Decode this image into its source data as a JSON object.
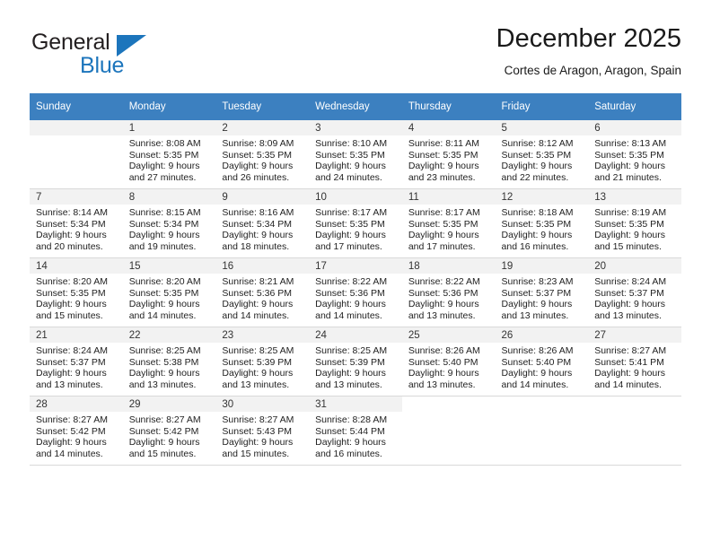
{
  "brand": {
    "name_top": "General",
    "name_bottom": "Blue",
    "triangle_color": "#1c75bc"
  },
  "header": {
    "title": "December 2025",
    "subtitle": "Cortes de Aragon, Aragon, Spain"
  },
  "weekday_headers": [
    "Sunday",
    "Monday",
    "Tuesday",
    "Wednesday",
    "Thursday",
    "Friday",
    "Saturday"
  ],
  "colors": {
    "header_row_bg": "#3c80c0",
    "header_row_text": "#ffffff",
    "daynum_bg": "#f2f2f2",
    "cell_border": "#d9d9d9",
    "text": "#222222"
  },
  "weeks": [
    [
      {
        "day": "",
        "sunrise": "",
        "sunset": "",
        "daylight_line1": "",
        "daylight_line2": ""
      },
      {
        "day": "1",
        "sunrise": "Sunrise: 8:08 AM",
        "sunset": "Sunset: 5:35 PM",
        "daylight_line1": "Daylight: 9 hours",
        "daylight_line2": "and 27 minutes."
      },
      {
        "day": "2",
        "sunrise": "Sunrise: 8:09 AM",
        "sunset": "Sunset: 5:35 PM",
        "daylight_line1": "Daylight: 9 hours",
        "daylight_line2": "and 26 minutes."
      },
      {
        "day": "3",
        "sunrise": "Sunrise: 8:10 AM",
        "sunset": "Sunset: 5:35 PM",
        "daylight_line1": "Daylight: 9 hours",
        "daylight_line2": "and 24 minutes."
      },
      {
        "day": "4",
        "sunrise": "Sunrise: 8:11 AM",
        "sunset": "Sunset: 5:35 PM",
        "daylight_line1": "Daylight: 9 hours",
        "daylight_line2": "and 23 minutes."
      },
      {
        "day": "5",
        "sunrise": "Sunrise: 8:12 AM",
        "sunset": "Sunset: 5:35 PM",
        "daylight_line1": "Daylight: 9 hours",
        "daylight_line2": "and 22 minutes."
      },
      {
        "day": "6",
        "sunrise": "Sunrise: 8:13 AM",
        "sunset": "Sunset: 5:35 PM",
        "daylight_line1": "Daylight: 9 hours",
        "daylight_line2": "and 21 minutes."
      }
    ],
    [
      {
        "day": "7",
        "sunrise": "Sunrise: 8:14 AM",
        "sunset": "Sunset: 5:34 PM",
        "daylight_line1": "Daylight: 9 hours",
        "daylight_line2": "and 20 minutes."
      },
      {
        "day": "8",
        "sunrise": "Sunrise: 8:15 AM",
        "sunset": "Sunset: 5:34 PM",
        "daylight_line1": "Daylight: 9 hours",
        "daylight_line2": "and 19 minutes."
      },
      {
        "day": "9",
        "sunrise": "Sunrise: 8:16 AM",
        "sunset": "Sunset: 5:34 PM",
        "daylight_line1": "Daylight: 9 hours",
        "daylight_line2": "and 18 minutes."
      },
      {
        "day": "10",
        "sunrise": "Sunrise: 8:17 AM",
        "sunset": "Sunset: 5:35 PM",
        "daylight_line1": "Daylight: 9 hours",
        "daylight_line2": "and 17 minutes."
      },
      {
        "day": "11",
        "sunrise": "Sunrise: 8:17 AM",
        "sunset": "Sunset: 5:35 PM",
        "daylight_line1": "Daylight: 9 hours",
        "daylight_line2": "and 17 minutes."
      },
      {
        "day": "12",
        "sunrise": "Sunrise: 8:18 AM",
        "sunset": "Sunset: 5:35 PM",
        "daylight_line1": "Daylight: 9 hours",
        "daylight_line2": "and 16 minutes."
      },
      {
        "day": "13",
        "sunrise": "Sunrise: 8:19 AM",
        "sunset": "Sunset: 5:35 PM",
        "daylight_line1": "Daylight: 9 hours",
        "daylight_line2": "and 15 minutes."
      }
    ],
    [
      {
        "day": "14",
        "sunrise": "Sunrise: 8:20 AM",
        "sunset": "Sunset: 5:35 PM",
        "daylight_line1": "Daylight: 9 hours",
        "daylight_line2": "and 15 minutes."
      },
      {
        "day": "15",
        "sunrise": "Sunrise: 8:20 AM",
        "sunset": "Sunset: 5:35 PM",
        "daylight_line1": "Daylight: 9 hours",
        "daylight_line2": "and 14 minutes."
      },
      {
        "day": "16",
        "sunrise": "Sunrise: 8:21 AM",
        "sunset": "Sunset: 5:36 PM",
        "daylight_line1": "Daylight: 9 hours",
        "daylight_line2": "and 14 minutes."
      },
      {
        "day": "17",
        "sunrise": "Sunrise: 8:22 AM",
        "sunset": "Sunset: 5:36 PM",
        "daylight_line1": "Daylight: 9 hours",
        "daylight_line2": "and 14 minutes."
      },
      {
        "day": "18",
        "sunrise": "Sunrise: 8:22 AM",
        "sunset": "Sunset: 5:36 PM",
        "daylight_line1": "Daylight: 9 hours",
        "daylight_line2": "and 13 minutes."
      },
      {
        "day": "19",
        "sunrise": "Sunrise: 8:23 AM",
        "sunset": "Sunset: 5:37 PM",
        "daylight_line1": "Daylight: 9 hours",
        "daylight_line2": "and 13 minutes."
      },
      {
        "day": "20",
        "sunrise": "Sunrise: 8:24 AM",
        "sunset": "Sunset: 5:37 PM",
        "daylight_line1": "Daylight: 9 hours",
        "daylight_line2": "and 13 minutes."
      }
    ],
    [
      {
        "day": "21",
        "sunrise": "Sunrise: 8:24 AM",
        "sunset": "Sunset: 5:37 PM",
        "daylight_line1": "Daylight: 9 hours",
        "daylight_line2": "and 13 minutes."
      },
      {
        "day": "22",
        "sunrise": "Sunrise: 8:25 AM",
        "sunset": "Sunset: 5:38 PM",
        "daylight_line1": "Daylight: 9 hours",
        "daylight_line2": "and 13 minutes."
      },
      {
        "day": "23",
        "sunrise": "Sunrise: 8:25 AM",
        "sunset": "Sunset: 5:39 PM",
        "daylight_line1": "Daylight: 9 hours",
        "daylight_line2": "and 13 minutes."
      },
      {
        "day": "24",
        "sunrise": "Sunrise: 8:25 AM",
        "sunset": "Sunset: 5:39 PM",
        "daylight_line1": "Daylight: 9 hours",
        "daylight_line2": "and 13 minutes."
      },
      {
        "day": "25",
        "sunrise": "Sunrise: 8:26 AM",
        "sunset": "Sunset: 5:40 PM",
        "daylight_line1": "Daylight: 9 hours",
        "daylight_line2": "and 13 minutes."
      },
      {
        "day": "26",
        "sunrise": "Sunrise: 8:26 AM",
        "sunset": "Sunset: 5:40 PM",
        "daylight_line1": "Daylight: 9 hours",
        "daylight_line2": "and 14 minutes."
      },
      {
        "day": "27",
        "sunrise": "Sunrise: 8:27 AM",
        "sunset": "Sunset: 5:41 PM",
        "daylight_line1": "Daylight: 9 hours",
        "daylight_line2": "and 14 minutes."
      }
    ],
    [
      {
        "day": "28",
        "sunrise": "Sunrise: 8:27 AM",
        "sunset": "Sunset: 5:42 PM",
        "daylight_line1": "Daylight: 9 hours",
        "daylight_line2": "and 14 minutes."
      },
      {
        "day": "29",
        "sunrise": "Sunrise: 8:27 AM",
        "sunset": "Sunset: 5:42 PM",
        "daylight_line1": "Daylight: 9 hours",
        "daylight_line2": "and 15 minutes."
      },
      {
        "day": "30",
        "sunrise": "Sunrise: 8:27 AM",
        "sunset": "Sunset: 5:43 PM",
        "daylight_line1": "Daylight: 9 hours",
        "daylight_line2": "and 15 minutes."
      },
      {
        "day": "31",
        "sunrise": "Sunrise: 8:28 AM",
        "sunset": "Sunset: 5:44 PM",
        "daylight_line1": "Daylight: 9 hours",
        "daylight_line2": "and 16 minutes."
      },
      {
        "day": "",
        "sunrise": "",
        "sunset": "",
        "daylight_line1": "",
        "daylight_line2": ""
      },
      {
        "day": "",
        "sunrise": "",
        "sunset": "",
        "daylight_line1": "",
        "daylight_line2": ""
      },
      {
        "day": "",
        "sunrise": "",
        "sunset": "",
        "daylight_line1": "",
        "daylight_line2": ""
      }
    ]
  ]
}
